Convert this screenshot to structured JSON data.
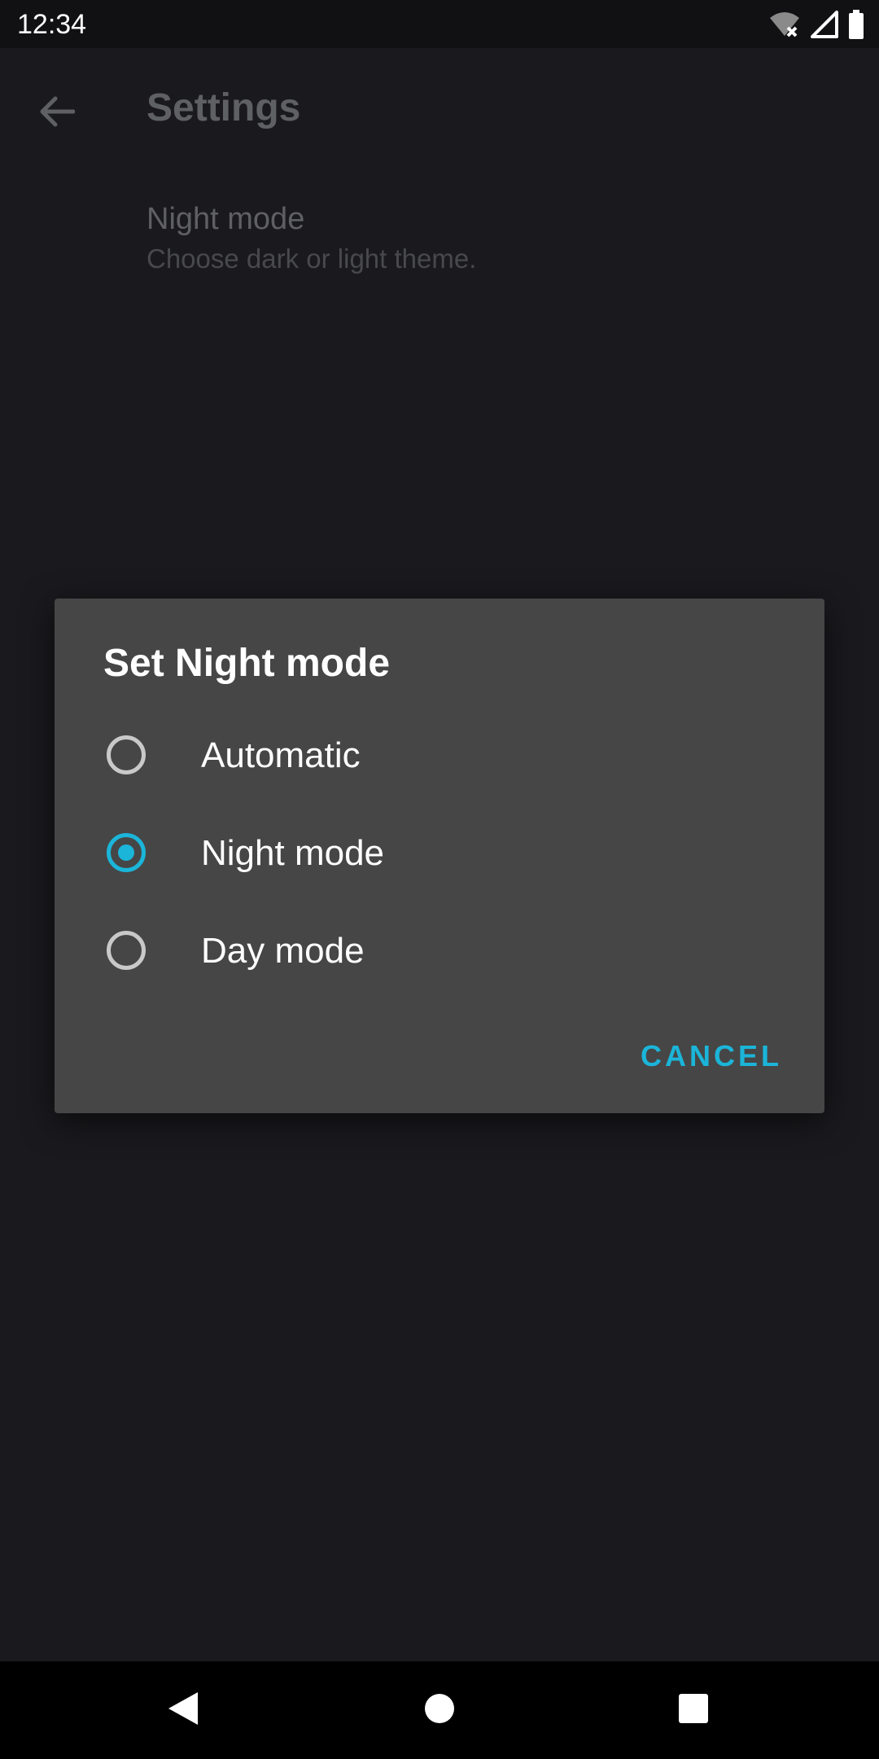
{
  "status_bar": {
    "time": "12:34",
    "icons": [
      "wifi-off-icon",
      "cellular-signal-icon",
      "battery-full-icon"
    ]
  },
  "app_bar": {
    "title": "Settings",
    "back_icon": "arrow-back-icon"
  },
  "preference": {
    "title": "Night mode",
    "summary": "Choose dark or light theme."
  },
  "dialog": {
    "title": "Set Night mode",
    "options": [
      {
        "label": "Automatic",
        "checked": false
      },
      {
        "label": "Night mode",
        "checked": true
      },
      {
        "label": "Day mode",
        "checked": false
      }
    ],
    "cancel_label": "CANCEL"
  },
  "nav_bar": {
    "icons": [
      "back-triangle-icon",
      "home-circle-icon",
      "recents-square-icon"
    ]
  },
  "colors": {
    "accent": "#1bb5d9",
    "background": "#1a1a1e",
    "dialog_background": "#464646"
  }
}
